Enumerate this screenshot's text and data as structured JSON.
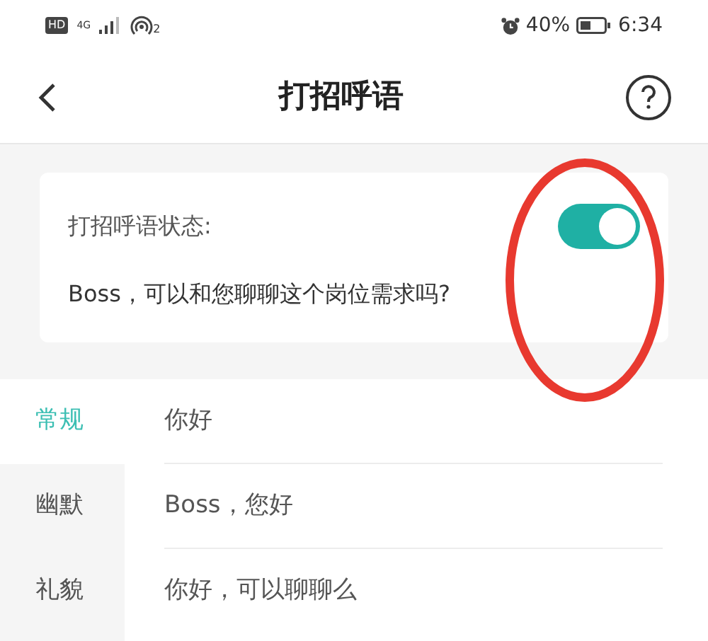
{
  "status_bar": {
    "hd": "HD",
    "network": "4G",
    "hotspot_count": "2",
    "battery": "40%",
    "time": "6:34"
  },
  "header": {
    "title": "打招呼语"
  },
  "greeting_status": {
    "label": "打招呼语状态:",
    "on": true,
    "current": "Boss，可以和您聊聊这个岗位需求吗?"
  },
  "categories": [
    {
      "label": "常规",
      "selected": true
    },
    {
      "label": "幽默",
      "selected": false
    },
    {
      "label": "礼貌",
      "selected": false
    }
  ],
  "greetings": [
    "你好",
    "Boss，您好",
    "你好，可以聊聊么"
  ]
}
